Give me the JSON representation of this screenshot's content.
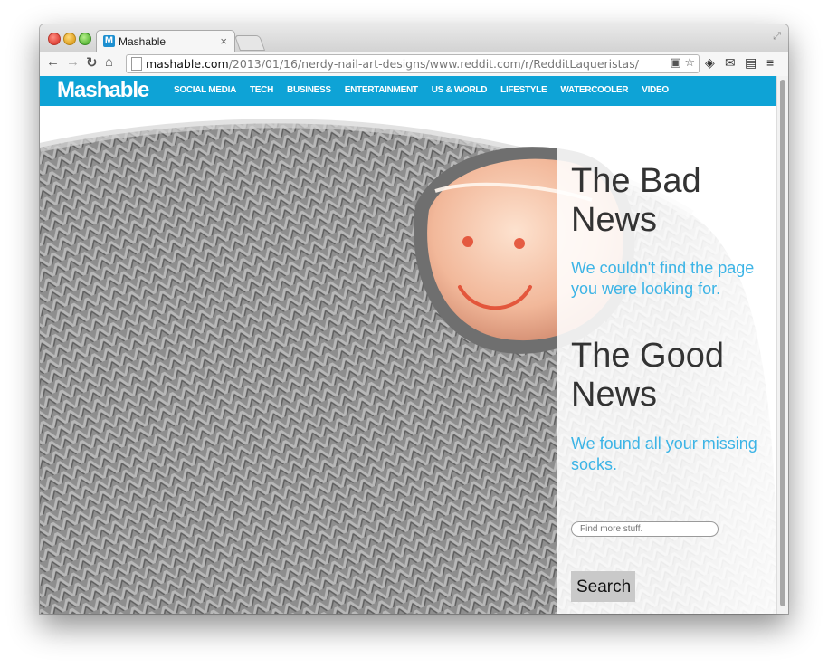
{
  "browser": {
    "tab_title": "Mashable",
    "favicon_letter": "M",
    "tab_close": "×",
    "url_domain": "mashable.com",
    "url_path": "/2013/01/16/nerdy-nail-art-designs/www.reddit.com/r/RedditLaqueristas/"
  },
  "site": {
    "brand": "Mashable",
    "nav": [
      "SOCIAL MEDIA",
      "TECH",
      "BUSINESS",
      "ENTERTAINMENT",
      "US & WORLD",
      "LIFESTYLE",
      "WATERCOOLER",
      "VIDEO"
    ],
    "brand_color": "#0ea3d6"
  },
  "error": {
    "bad_heading": "The Bad News",
    "bad_text": "We couldn't find the page you were looking for.",
    "good_heading": "The Good News",
    "good_text": "We found all your missing socks.",
    "search_placeholder": "Find more stuff.",
    "search_button": "Search"
  }
}
